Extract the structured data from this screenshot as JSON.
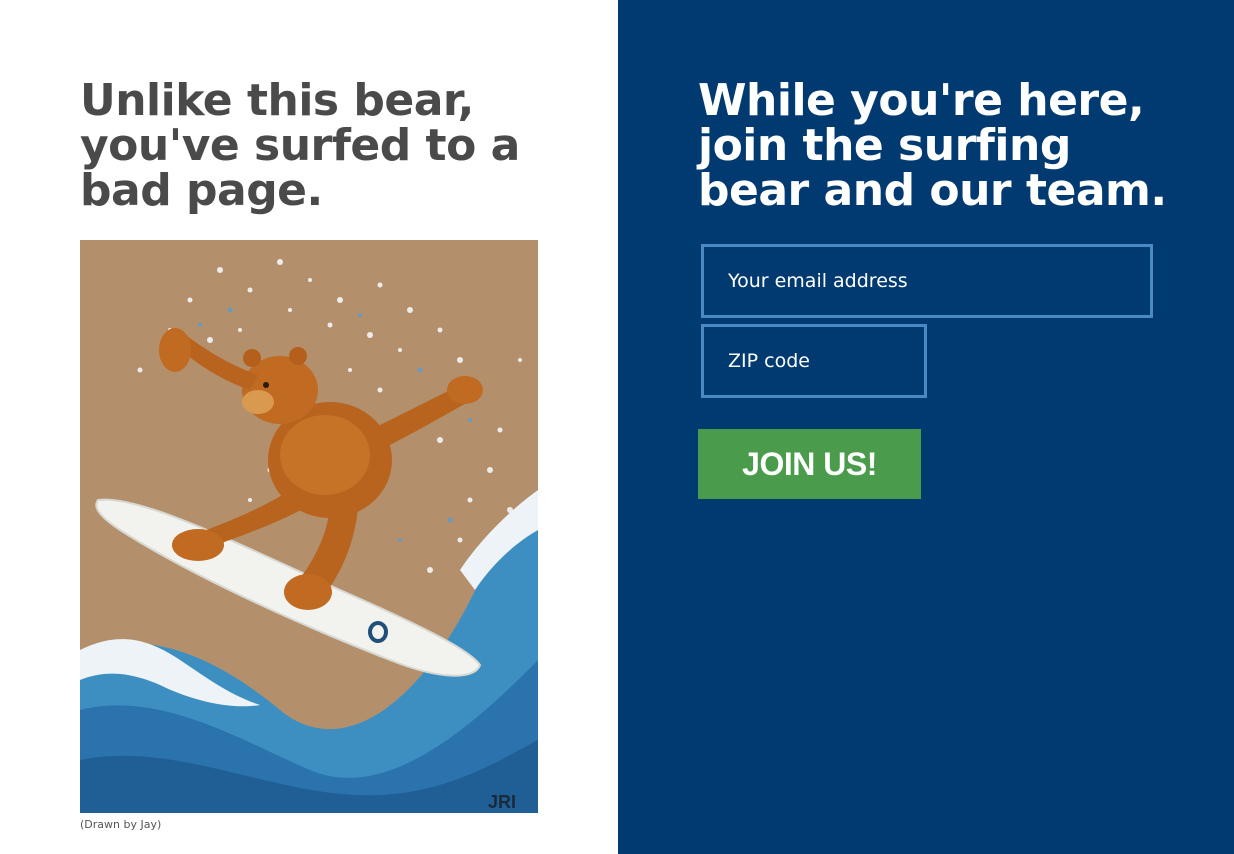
{
  "left": {
    "headline_lines": [
      "Unlike this bear,",
      "you've surfed to a",
      "bad page."
    ],
    "artwork_signature": "JRI",
    "caption": "(Drawn by Jay)"
  },
  "right": {
    "headline_lines": [
      "While you're here,",
      "join the surfing",
      "bear and our team."
    ],
    "email_placeholder": "Your email address",
    "zip_placeholder": "ZIP code",
    "join_label": "JOIN US!"
  },
  "colors": {
    "left_bg": "#ffffff",
    "right_bg": "#003a70",
    "headline_left": "#4a4a4a",
    "field_border": "#4a8ac4",
    "button_bg": "#4a9b4c"
  }
}
